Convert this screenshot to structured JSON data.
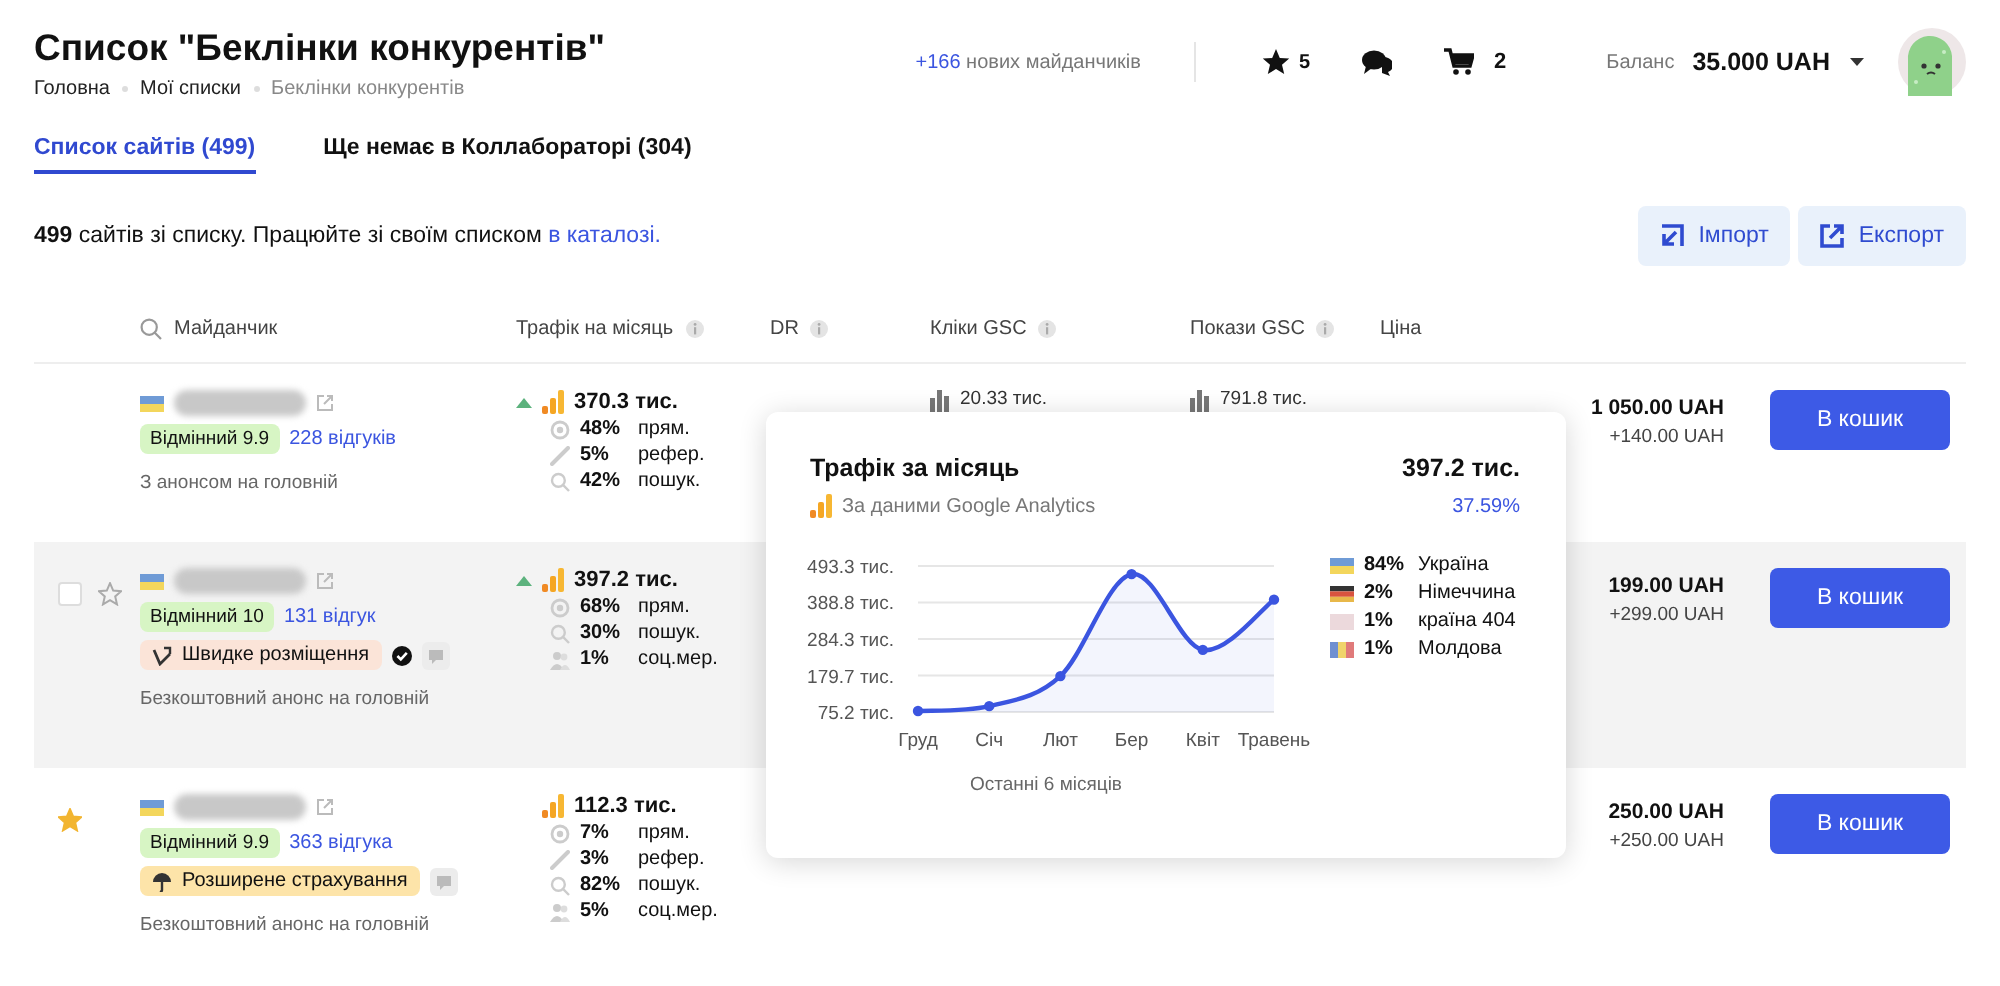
{
  "header": {
    "title": "Список \"Беклінки конкурентів\"",
    "breadcrumbs": [
      {
        "label": "Головна",
        "current": false
      },
      {
        "label": "Мої списки",
        "current": false
      },
      {
        "label": "Беклінки конкурентів",
        "current": true
      }
    ],
    "new_sites": {
      "count": "+166",
      "text": "нових майданчиків"
    },
    "favorites_count": "5",
    "cart_count": "2",
    "balance_label": "Баланс",
    "balance": "35.000 UAH"
  },
  "tabs": [
    {
      "label": "Список сайтів (499)",
      "selected": true
    },
    {
      "label": "Ще немає в Коллабораторі (304)",
      "selected": false
    }
  ],
  "summary": {
    "text": "**499** сайтів зі списку. Працюйте зі своїм списком",
    "link": "в каталозі."
  },
  "actions": [
    {
      "kind": "import",
      "label": "Імпорт"
    },
    {
      "kind": "export",
      "label": "Експорт"
    }
  ],
  "table": {
    "columns": [
      {
        "label": "Майданчик",
        "search": true,
        "info": false
      },
      {
        "label": "Трафік на місяць",
        "search": false,
        "info": true
      },
      {
        "label": "DR",
        "search": false,
        "info": true
      },
      {
        "label": "Кліки GSC",
        "search": false,
        "info": true
      },
      {
        "label": "Покази GSC",
        "search": false,
        "info": true
      },
      {
        "label": "Ціна",
        "search": false,
        "info": false
      }
    ],
    "rows": [
      {
        "hovered": false,
        "checked": false,
        "starred": false,
        "rating": "Відмінний 9.9",
        "reviews": "228 відгуків",
        "note": "З анонсом на головній",
        "trend_up": true,
        "traffic": "370.3 тис.",
        "breakdown": [
          {
            "kind": "direct",
            "pct": "48%",
            "label": "прям."
          },
          {
            "kind": "referral",
            "pct": "5%",
            "label": "рефер."
          },
          {
            "kind": "search",
            "pct": "42%",
            "label": "пошук."
          }
        ],
        "clicks": "20.33 тис.",
        "impressions": "791.8 тис.",
        "price": "1 050.00 UAH",
        "extra": "+140.00 UAH",
        "button": "В кошик"
      },
      {
        "hovered": true,
        "checked": false,
        "starred": false,
        "rating": "Відмінний 10",
        "reviews": "131 відгук",
        "badge": {
          "kind": "fast",
          "label": "Швидке розміщення",
          "verified": true
        },
        "note": "Безкоштовний анонс на головній",
        "trend_up": true,
        "traffic": "397.2 тис.",
        "breakdown": [
          {
            "kind": "direct",
            "pct": "68%",
            "label": "прям."
          },
          {
            "kind": "search",
            "pct": "30%",
            "label": "пошук."
          },
          {
            "kind": "social",
            "pct": "1%",
            "label": "соц.мер."
          }
        ],
        "price": "199.00 UAH",
        "extra": "+299.00 UAH",
        "button": "В кошик"
      },
      {
        "hovered": false,
        "checked": false,
        "starred": true,
        "rating": "Відмінний 9.9",
        "reviews": "363 відгука",
        "badge": {
          "kind": "insurance",
          "label": "Розширене страхування",
          "verified": false
        },
        "note": "Безкоштовний анонс на головній",
        "trend_up": false,
        "traffic": "112.3 тис.",
        "breakdown": [
          {
            "kind": "direct",
            "pct": "7%",
            "label": "прям."
          },
          {
            "kind": "referral",
            "pct": "3%",
            "label": "рефер."
          },
          {
            "kind": "search",
            "pct": "82%",
            "label": "пошук."
          },
          {
            "kind": "social",
            "pct": "5%",
            "label": "соц.мер."
          }
        ],
        "price": "250.00 UAH",
        "extra": "+250.00 UAH",
        "button": "В кошик"
      }
    ]
  },
  "popup": {
    "title": "Трафік за місяць",
    "total": "397.2 тис.",
    "source": "За даними Google Analytics",
    "change": "37.59%",
    "caption": "Останні 6 місяців",
    "chart_data": {
      "type": "line",
      "categories": [
        "Груд",
        "Січ",
        "Лют",
        "Бер",
        "Квіт",
        "Травень"
      ],
      "grid": true,
      "series": [
        {
          "color": "#3b55e0",
          "marker": true,
          "values": [
            78,
            92,
            178,
            470,
            253,
            397
          ]
        }
      ],
      "ylim": [
        75.2,
        493.3
      ],
      "yticks": [
        {
          "value": 75.2,
          "label": "75.2 тис."
        },
        {
          "value": 179.7,
          "label": "179.7 тис."
        },
        {
          "value": 284.3,
          "label": "284.3 тис."
        },
        {
          "value": 388.8,
          "label": "388.8 тис."
        },
        {
          "value": 493.3,
          "label": "493.3 тис."
        }
      ]
    },
    "countries": [
      {
        "kind": "ua",
        "pct": "84%",
        "name": "Україна"
      },
      {
        "kind": "de",
        "pct": "2%",
        "name": "Німеччина"
      },
      {
        "kind": "unknown",
        "pct": "1%",
        "name": "країна 404"
      },
      {
        "kind": "md",
        "pct": "1%",
        "name": "Молдова"
      }
    ]
  }
}
